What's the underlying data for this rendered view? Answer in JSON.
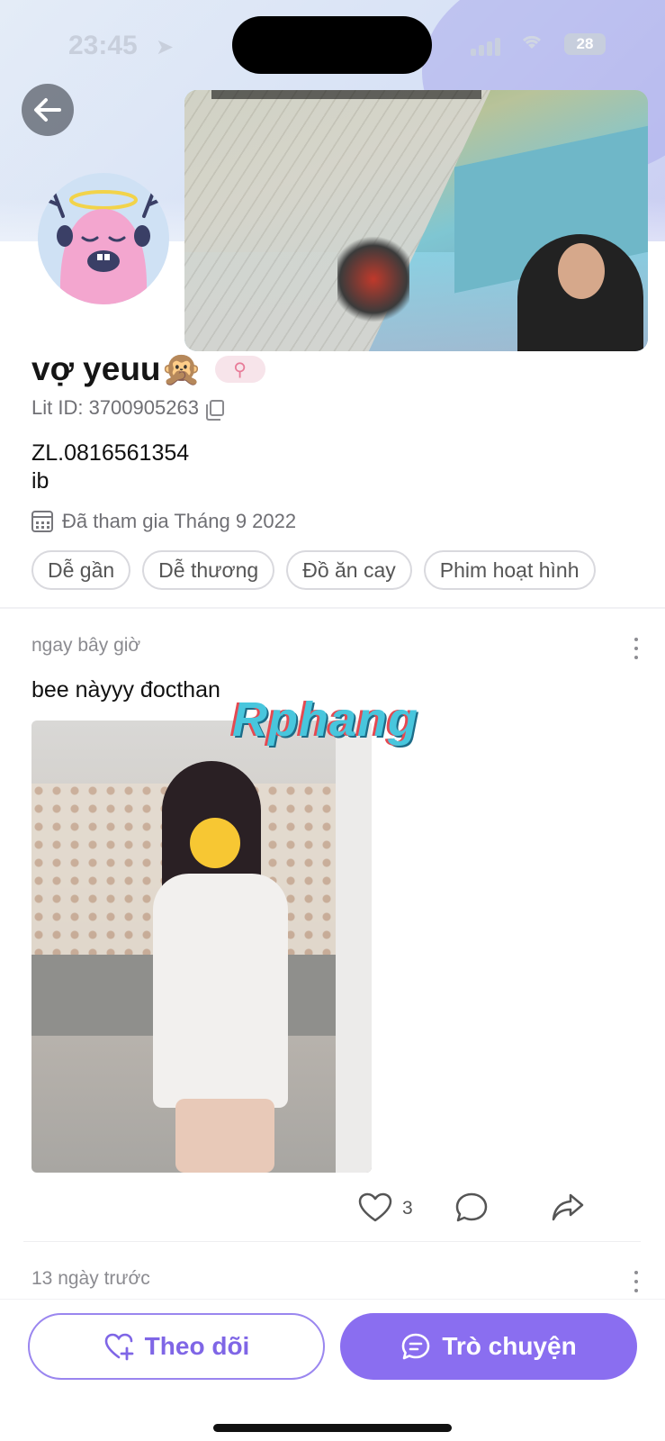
{
  "status_bar": {
    "time": "23:45",
    "battery": "28"
  },
  "profile": {
    "name": "vợ yeuu🙊",
    "lit_id": "Lit ID: 3700905263",
    "bio_lines": [
      "ZL.0816561354",
      "ib"
    ],
    "joined": "Đã tham gia Tháng 9 2022",
    "tags": [
      "Dễ gần",
      "Dễ thương",
      "Đồ ăn cay",
      "Phim hoạt hình"
    ],
    "gender_symbol": "⚲"
  },
  "posts": [
    {
      "time": "ngay bây giờ",
      "text": "bee nàyyy đocthan",
      "likes": "3"
    },
    {
      "time": "13 ngày trước"
    }
  ],
  "watermark": "Rphang",
  "bottom_bar": {
    "follow_label": "Theo dõi",
    "chat_label": "Trò chuyện"
  },
  "colors": {
    "accent": "#8a6ef0",
    "accent_text": "#7f66e6",
    "gender_pink": "#e87b98"
  },
  "icons": [
    "back-arrow-icon",
    "copy-icon",
    "calendar-icon",
    "more-vertical-icon",
    "heart-icon",
    "comment-icon",
    "share-icon",
    "heart-plus-icon",
    "chat-bubble-icon"
  ]
}
